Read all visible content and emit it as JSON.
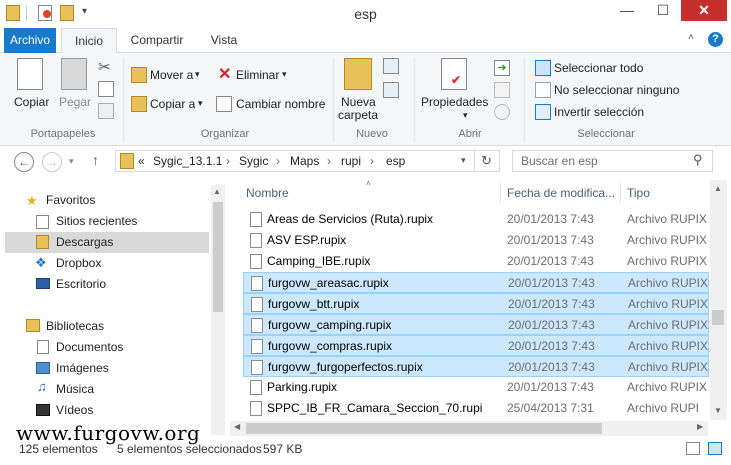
{
  "window": {
    "title": "esp",
    "minimize": "—",
    "maximize": "☐",
    "close": "✕"
  },
  "tabs": [
    "Archivo",
    "Inicio",
    "Compartir",
    "Vista"
  ],
  "ribbon": {
    "copy": "Copiar",
    "paste": "Pegar",
    "group_clipboard": "Portapapeles",
    "move_to": "Mover a",
    "copy_to": "Copiar a",
    "delete": "Eliminar",
    "rename": "Cambiar nombre",
    "group_organize": "Organizar",
    "new_folder_l1": "Nueva",
    "new_folder_l2": "carpeta",
    "group_new": "Nuevo",
    "properties": "Propiedades",
    "group_open": "Abrir",
    "select_all": "Seleccionar todo",
    "select_none": "No seleccionar ninguno",
    "invert_selection": "Invertir selección",
    "group_select": "Seleccionar"
  },
  "address": {
    "prefix": "«",
    "crumbs": [
      "Sygic_13.1.1",
      "Sygic",
      "Maps",
      "rupi",
      "esp"
    ],
    "search_placeholder": "Buscar en esp"
  },
  "nav": {
    "favorites": "Favoritos",
    "recent": "Sitios recientes",
    "downloads": "Descargas",
    "dropbox": "Dropbox",
    "desktop": "Escritorio",
    "libraries": "Bibliotecas",
    "documents": "Documentos",
    "images": "Imágenes",
    "music": "Música",
    "videos": "Vídeos"
  },
  "columns": {
    "name": "Nombre",
    "date": "Fecha de modifica...",
    "type": "Tipo"
  },
  "files": [
    {
      "name": "Areas de Servicios (Ruta).rupix",
      "date": "20/01/2013 7:43",
      "type": "Archivo RUPIX",
      "selected": false
    },
    {
      "name": "ASV ESP.rupix",
      "date": "20/01/2013 7:43",
      "type": "Archivo RUPIX",
      "selected": false
    },
    {
      "name": "Camping_IBE.rupix",
      "date": "20/01/2013 7:43",
      "type": "Archivo RUPIX",
      "selected": false
    },
    {
      "name": "furgovw_areasac.rupix",
      "date": "20/01/2013 7:43",
      "type": "Archivo RUPIX",
      "selected": true
    },
    {
      "name": "furgovw_btt.rupix",
      "date": "20/01/2013 7:43",
      "type": "Archivo RUPIX",
      "selected": true
    },
    {
      "name": "furgovw_camping.rupix",
      "date": "20/01/2013 7:43",
      "type": "Archivo RUPIX",
      "selected": true
    },
    {
      "name": "furgovw_compras.rupix",
      "date": "20/01/2013 7:43",
      "type": "Archivo RUPIX",
      "selected": true
    },
    {
      "name": "furgovw_furgoperfectos.rupix",
      "date": "20/01/2013 7:43",
      "type": "Archivo RUPIX",
      "selected": true
    },
    {
      "name": "Parking.rupix",
      "date": "20/01/2013 7:43",
      "type": "Archivo RUPIX",
      "selected": false
    },
    {
      "name": "SPPC_IB_FR_Camara_Seccion_70.rupi",
      "date": "25/04/2013 7:31",
      "type": "Archivo RUPI",
      "selected": false
    }
  ],
  "status": {
    "count": "125 elementos",
    "selected": "5 elementos seleccionados",
    "size": "597 KB"
  },
  "watermark": "www.furgovw.org",
  "colors": {
    "accent": "#1979ca",
    "selection": "#cce8ff",
    "close": "#c7302a"
  }
}
